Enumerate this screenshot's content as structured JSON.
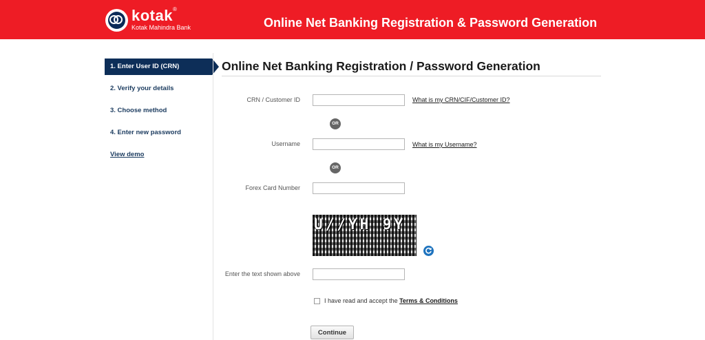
{
  "header": {
    "logo_name": "kotak",
    "logo_registered": "®",
    "logo_subtitle": "Kotak Mahindra Bank",
    "title": "Online Net Banking Registration & Password Generation",
    "background_color": "#ee1c25"
  },
  "sidebar": {
    "steps": [
      {
        "label": "1. Enter User ID (CRN)",
        "active": true
      },
      {
        "label": "2. Verify your details",
        "active": false
      },
      {
        "label": "3. Choose method",
        "active": false
      },
      {
        "label": "4. Enter new password",
        "active": false
      }
    ],
    "view_demo": "View demo",
    "active_color": "#0d2e58"
  },
  "main": {
    "title": "Online Net Banking Registration / Password Generation",
    "crn": {
      "label": "CRN / Customer ID",
      "value": "",
      "help": "What is my CRN/CIF/Customer ID?"
    },
    "or_1": "OR",
    "username": {
      "label": "Username",
      "value": "",
      "help": "What is my Username?"
    },
    "or_2": "OR",
    "forex": {
      "label": "Forex Card Number",
      "value": ""
    },
    "captcha": {
      "text": "U//YH 9Y",
      "refresh_icon": "refresh-icon"
    },
    "captcha_input": {
      "label": "Enter the text shown above",
      "value": ""
    },
    "terms": {
      "checked": false,
      "prefix": "I have read and accept the",
      "link": "Terms & Conditions"
    },
    "continue_label": "Continue"
  }
}
